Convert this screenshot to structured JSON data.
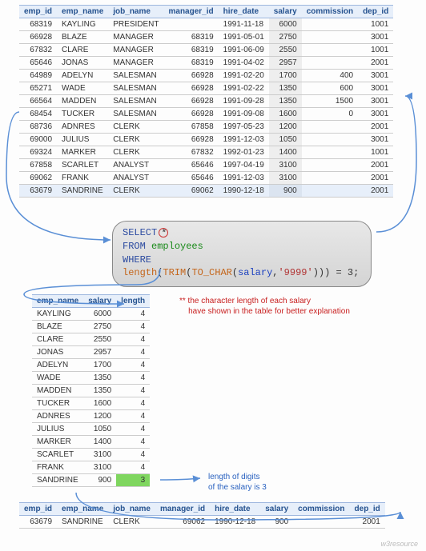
{
  "main_table": {
    "headers": [
      "emp_id",
      "emp_name",
      "job_name",
      "manager_id",
      "hire_date",
      "salary",
      "commission",
      "dep_id"
    ],
    "rows": [
      {
        "emp_id": "68319",
        "emp_name": "KAYLING",
        "job_name": "PRESIDENT",
        "manager_id": "",
        "hire_date": "1991-11-18",
        "salary": "6000",
        "commission": "",
        "dep_id": "1001",
        "hl": false
      },
      {
        "emp_id": "66928",
        "emp_name": "BLAZE",
        "job_name": "MANAGER",
        "manager_id": "68319",
        "hire_date": "1991-05-01",
        "salary": "2750",
        "commission": "",
        "dep_id": "3001",
        "hl": false
      },
      {
        "emp_id": "67832",
        "emp_name": "CLARE",
        "job_name": "MANAGER",
        "manager_id": "68319",
        "hire_date": "1991-06-09",
        "salary": "2550",
        "commission": "",
        "dep_id": "1001",
        "hl": false
      },
      {
        "emp_id": "65646",
        "emp_name": "JONAS",
        "job_name": "MANAGER",
        "manager_id": "68319",
        "hire_date": "1991-04-02",
        "salary": "2957",
        "commission": "",
        "dep_id": "2001",
        "hl": false
      },
      {
        "emp_id": "64989",
        "emp_name": "ADELYN",
        "job_name": "SALESMAN",
        "manager_id": "66928",
        "hire_date": "1991-02-20",
        "salary": "1700",
        "commission": "400",
        "dep_id": "3001",
        "hl": false
      },
      {
        "emp_id": "65271",
        "emp_name": "WADE",
        "job_name": "SALESMAN",
        "manager_id": "66928",
        "hire_date": "1991-02-22",
        "salary": "1350",
        "commission": "600",
        "dep_id": "3001",
        "hl": false
      },
      {
        "emp_id": "66564",
        "emp_name": "MADDEN",
        "job_name": "SALESMAN",
        "manager_id": "66928",
        "hire_date": "1991-09-28",
        "salary": "1350",
        "commission": "1500",
        "dep_id": "3001",
        "hl": false
      },
      {
        "emp_id": "68454",
        "emp_name": "TUCKER",
        "job_name": "SALESMAN",
        "manager_id": "66928",
        "hire_date": "1991-09-08",
        "salary": "1600",
        "commission": "0",
        "dep_id": "3001",
        "hl": false
      },
      {
        "emp_id": "68736",
        "emp_name": "ADNRES",
        "job_name": "CLERK",
        "manager_id": "67858",
        "hire_date": "1997-05-23",
        "salary": "1200",
        "commission": "",
        "dep_id": "2001",
        "hl": false
      },
      {
        "emp_id": "69000",
        "emp_name": "JULIUS",
        "job_name": "CLERK",
        "manager_id": "66928",
        "hire_date": "1991-12-03",
        "salary": "1050",
        "commission": "",
        "dep_id": "3001",
        "hl": false
      },
      {
        "emp_id": "69324",
        "emp_name": "MARKER",
        "job_name": "CLERK",
        "manager_id": "67832",
        "hire_date": "1992-01-23",
        "salary": "1400",
        "commission": "",
        "dep_id": "1001",
        "hl": false
      },
      {
        "emp_id": "67858",
        "emp_name": "SCARLET",
        "job_name": "ANALYST",
        "manager_id": "65646",
        "hire_date": "1997-04-19",
        "salary": "3100",
        "commission": "",
        "dep_id": "2001",
        "hl": false
      },
      {
        "emp_id": "69062",
        "emp_name": "FRANK",
        "job_name": "ANALYST",
        "manager_id": "65646",
        "hire_date": "1991-12-03",
        "salary": "3100",
        "commission": "",
        "dep_id": "2001",
        "hl": false
      },
      {
        "emp_id": "63679",
        "emp_name": "SANDRINE",
        "job_name": "CLERK",
        "manager_id": "69062",
        "hire_date": "1990-12-18",
        "salary": "900",
        "commission": "",
        "dep_id": "2001",
        "hl": true
      }
    ]
  },
  "sql": {
    "select": "SELECT",
    "from": "FROM",
    "where": "WHERE",
    "table": "employees",
    "fn1": "length",
    "fn2": "TRIM",
    "fn3": "TO_CHAR",
    "col": "salary",
    "fmt": "'9999'",
    "eq": "= 3;"
  },
  "length_table": {
    "headers": [
      "emp_name",
      "salary",
      "length"
    ],
    "rows": [
      {
        "emp_name": "KAYLING",
        "salary": "6000",
        "length": "4",
        "hl": false
      },
      {
        "emp_name": "BLAZE",
        "salary": "2750",
        "length": "4",
        "hl": false
      },
      {
        "emp_name": "CLARE",
        "salary": "2550",
        "length": "4",
        "hl": false
      },
      {
        "emp_name": "JONAS",
        "salary": "2957",
        "length": "4",
        "hl": false
      },
      {
        "emp_name": "ADELYN",
        "salary": "1700",
        "length": "4",
        "hl": false
      },
      {
        "emp_name": "WADE",
        "salary": "1350",
        "length": "4",
        "hl": false
      },
      {
        "emp_name": "MADDEN",
        "salary": "1350",
        "length": "4",
        "hl": false
      },
      {
        "emp_name": "TUCKER",
        "salary": "1600",
        "length": "4",
        "hl": false
      },
      {
        "emp_name": "ADNRES",
        "salary": "1200",
        "length": "4",
        "hl": false
      },
      {
        "emp_name": "JULIUS",
        "salary": "1050",
        "length": "4",
        "hl": false
      },
      {
        "emp_name": "MARKER",
        "salary": "1400",
        "length": "4",
        "hl": false
      },
      {
        "emp_name": "SCARLET",
        "salary": "3100",
        "length": "4",
        "hl": false
      },
      {
        "emp_name": "FRANK",
        "salary": "3100",
        "length": "4",
        "hl": false
      },
      {
        "emp_name": "SANDRINE",
        "salary": "900",
        "length": "3",
        "hl": true
      }
    ]
  },
  "result_table": {
    "headers": [
      "emp_id",
      "emp_name",
      "job_name",
      "manager_id",
      "hire_date",
      "salary",
      "commission",
      "dep_id"
    ],
    "rows": [
      {
        "emp_id": "63679",
        "emp_name": "SANDRINE",
        "job_name": "CLERK",
        "manager_id": "69062",
        "hire_date": "1990-12-18",
        "salary": "900",
        "commission": "",
        "dep_id": "2001"
      }
    ]
  },
  "notes": {
    "red1": "** the character length of each salary",
    "red2": "have shown in the table for better explanation",
    "blue1": "length of digits",
    "blue2": "of the salary is 3"
  },
  "watermark": "w3resource"
}
